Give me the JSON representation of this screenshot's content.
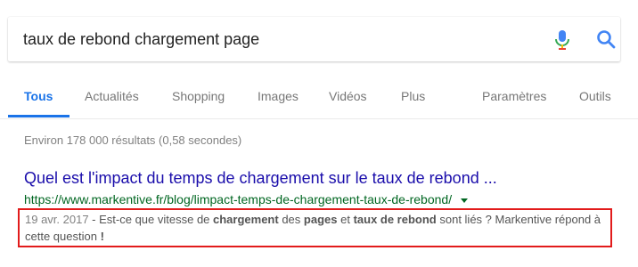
{
  "search": {
    "query": "taux de rebond chargement page"
  },
  "icons": {
    "mic": "microphone-icon",
    "search": "search-icon",
    "dropdown": "caret-down-icon"
  },
  "tabs": [
    {
      "label": "Tous",
      "active": true
    },
    {
      "label": "Actualités",
      "active": false
    },
    {
      "label": "Shopping",
      "active": false
    },
    {
      "label": "Images",
      "active": false
    },
    {
      "label": "Vidéos",
      "active": false
    },
    {
      "label": "Plus",
      "active": false
    },
    {
      "label": "Paramètres",
      "active": false
    },
    {
      "label": "Outils",
      "active": false
    }
  ],
  "stats": "Environ 178 000 résultats (0,58 secondes)",
  "result": {
    "title": "Quel est l'impact du temps de chargement sur le taux de rebond ...",
    "url": "https://www.markentive.fr/blog/limpact-temps-de-chargement-taux-de-rebond/",
    "date": "19 avr. 2017",
    "snippet_parts": [
      {
        "text": " - Est-ce que vitesse de ",
        "bold": false
      },
      {
        "text": "chargement",
        "bold": true
      },
      {
        "text": " des ",
        "bold": false
      },
      {
        "text": "pages",
        "bold": true
      },
      {
        "text": " et ",
        "bold": false
      },
      {
        "text": "taux de rebond",
        "bold": true
      },
      {
        "text": " sont liés ? Markentive répond à cette question ",
        "bold": false
      },
      {
        "text": "!",
        "bold": true
      }
    ]
  },
  "colors": {
    "accent_blue": "#1a73e8",
    "link": "#1a0dab",
    "url_green": "#006621",
    "highlight_red": "#e21b1b"
  }
}
